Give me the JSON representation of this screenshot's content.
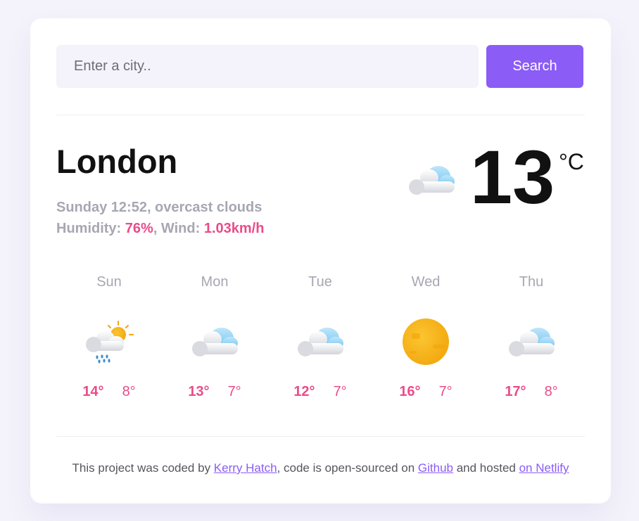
{
  "search": {
    "placeholder": "Enter a city..",
    "button_label": "Search"
  },
  "current": {
    "city": "London",
    "date_desc": "Sunday 12:52, overcast clouds",
    "humidity_label": "Humidity: ",
    "humidity_value": "76%",
    "wind_label": ", Wind: ",
    "wind_value": "1.03km/h",
    "temperature": "13",
    "unit": "°C",
    "icon": "cloud-icon"
  },
  "forecast": [
    {
      "day": "Sun",
      "max": "14°",
      "min": "8°",
      "icon": "rain-sun-icon"
    },
    {
      "day": "Mon",
      "max": "13°",
      "min": "7°",
      "icon": "cloud-icon"
    },
    {
      "day": "Tue",
      "max": "12°",
      "min": "7°",
      "icon": "cloud-icon"
    },
    {
      "day": "Wed",
      "max": "16°",
      "min": "7°",
      "icon": "sun-icon"
    },
    {
      "day": "Thu",
      "max": "17°",
      "min": "8°",
      "icon": "cloud-icon"
    }
  ],
  "footer": {
    "text1": "This project was coded by ",
    "link1": "Kerry Hatch",
    "text2": ", code is open-sourced on ",
    "link2": "Github",
    "text3": " and hosted ",
    "link3": "on Netlify"
  },
  "colors": {
    "accent": "#8b5cf6",
    "highlight": "#ea4c89",
    "muted": "#a7a7b3"
  }
}
